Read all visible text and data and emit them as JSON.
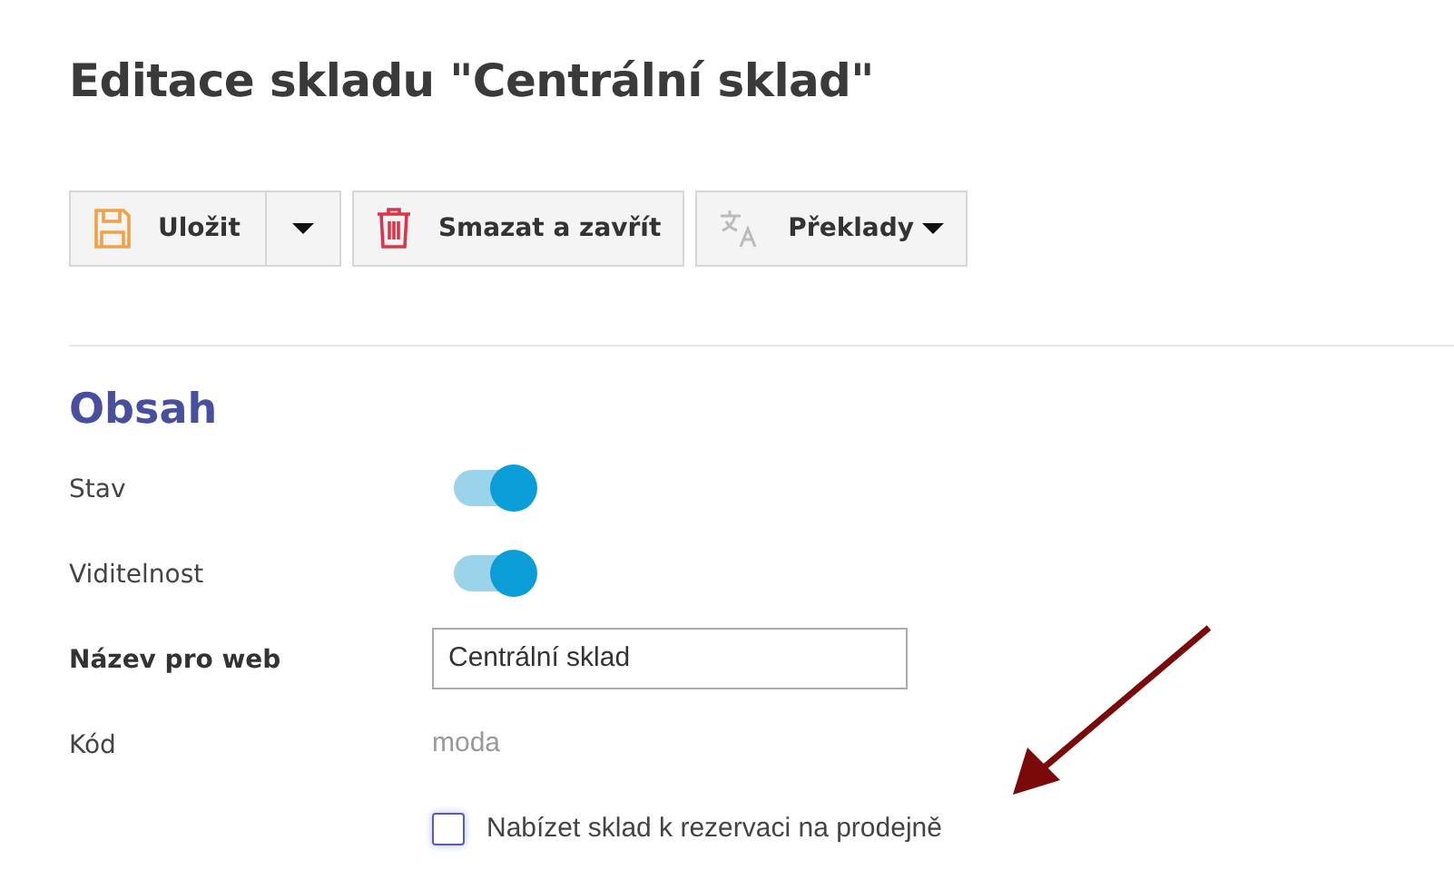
{
  "title": "Editace skladu \"Centrální sklad\"",
  "toolbar": [
    {
      "kind": "save",
      "label": "Uložit"
    },
    {
      "kind": "delete",
      "label": "Smazat a zavřít"
    },
    {
      "kind": "translate",
      "label": "Překlady"
    }
  ],
  "section": {
    "title": "Obsah"
  },
  "fields": [
    {
      "kind": "toggle",
      "label": "Stav",
      "bold": false,
      "on": true
    },
    {
      "kind": "toggle",
      "label": "Viditelnost",
      "bold": false,
      "on": true
    },
    {
      "kind": "text",
      "label": "Název pro web",
      "bold": true,
      "value": "Centrální sklad"
    },
    {
      "kind": "static",
      "label": "Kód",
      "bold": false,
      "value": "moda"
    },
    {
      "kind": "checkbox",
      "text": "Nabízet sklad k rezervaci na prodejně",
      "checked": false
    }
  ]
}
